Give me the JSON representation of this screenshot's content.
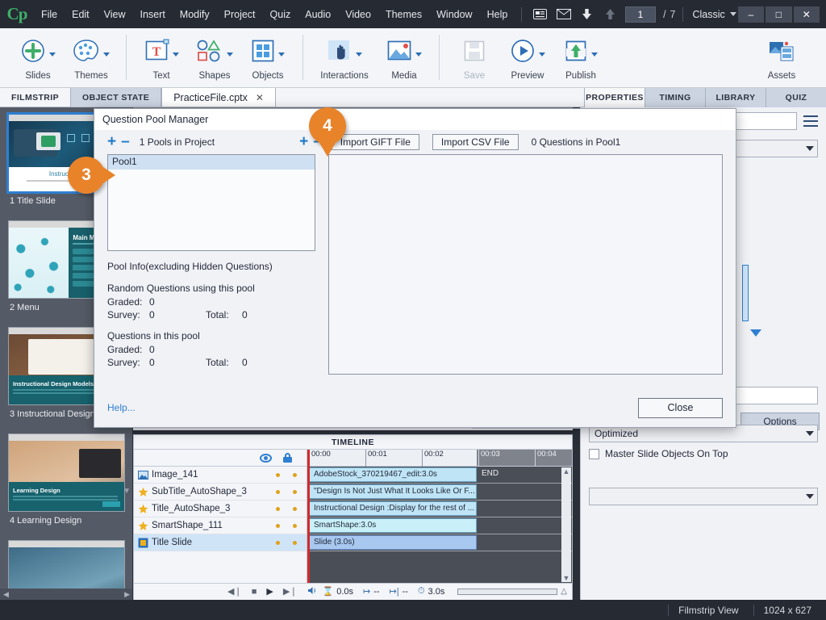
{
  "app": {
    "logo": "Cp",
    "menus": [
      "File",
      "Edit",
      "View",
      "Insert",
      "Modify",
      "Project",
      "Quiz",
      "Audio",
      "Video",
      "Themes",
      "Window",
      "Help"
    ],
    "page_current": "1",
    "page_separator": "/",
    "page_total": "7",
    "workspace": "Classic",
    "window_buttons": {
      "minimize": "–",
      "maximize": "□",
      "close": "✕"
    }
  },
  "ribbon": {
    "items": [
      {
        "label": "Slides",
        "icon": "add-slide-icon",
        "has_caret": true
      },
      {
        "label": "Themes",
        "icon": "palette-icon",
        "has_caret": true
      },
      {
        "label": "Text",
        "icon": "text-box-icon",
        "has_caret": true
      },
      {
        "label": "Shapes",
        "icon": "shapes-icon",
        "has_caret": true
      },
      {
        "label": "Objects",
        "icon": "objects-grid-icon",
        "has_caret": true
      },
      {
        "label": "Interactions",
        "icon": "hand-pointer-icon",
        "has_caret": true
      },
      {
        "label": "Media",
        "icon": "image-icon",
        "has_caret": true
      },
      {
        "label": "Save",
        "icon": "floppy-disk-icon",
        "has_caret": false,
        "disabled": true
      },
      {
        "label": "Preview",
        "icon": "play-circle-icon",
        "has_caret": true
      },
      {
        "label": "Publish",
        "icon": "publish-upload-icon",
        "has_caret": true
      },
      {
        "label": "Assets",
        "icon": "assets-icon",
        "has_caret": false
      }
    ]
  },
  "tabs": {
    "left": [
      {
        "label": "FILMSTRIP",
        "active": false
      },
      {
        "label": "OBJECT STATE",
        "active": false
      }
    ],
    "document": {
      "label": "PracticeFile.cptx",
      "close": "✕"
    },
    "right": [
      {
        "label": "PROPERTIES",
        "active": true
      },
      {
        "label": "TIMING",
        "active": false
      },
      {
        "label": "LIBRARY",
        "active": false
      },
      {
        "label": "QUIZ",
        "active": false
      }
    ]
  },
  "filmstrip": {
    "slides": [
      {
        "caption": "1 Title Slide",
        "selected": true,
        "art": "art1"
      },
      {
        "caption": "2 Menu",
        "selected": false,
        "art": "art2"
      },
      {
        "caption": "3 Instructional Design M...",
        "selected": false,
        "art": "art3"
      },
      {
        "caption": "4 Learning Design",
        "selected": false,
        "art": "art4"
      },
      {
        "caption": "",
        "selected": false,
        "art": "art5"
      }
    ],
    "thumb_titles": {
      "slide1_title": "Instructional",
      "slide2_title": "Main Menu",
      "slide3_title": "Instructional Design Models",
      "slide4_title": "Learning Design"
    }
  },
  "right_panel": {
    "options_button": "Options",
    "optimized_value": "Optimized",
    "master_slide_checkbox": "Master Slide Objects On Top"
  },
  "dialog": {
    "title": "Question Pool Manager",
    "pool_add": "+",
    "pool_remove": "–",
    "pools_count_label": "1 Pools in Project",
    "question_add": "+",
    "question_remove": "–",
    "import_gift": "Import GIFT File",
    "import_csv": "Import CSV File",
    "questions_count_label": "0 Questions in Pool1",
    "pools": [
      {
        "name": "Pool1",
        "selected": true
      }
    ],
    "pool_info": {
      "heading": "Pool Info(excluding Hidden Questions)",
      "section1_title": "Random Questions using this pool",
      "section1_graded_label": "Graded:",
      "section1_graded_value": "0",
      "section1_survey_label": "Survey:",
      "section1_survey_value": "0",
      "section1_total_label": "Total:",
      "section1_total_value": "0",
      "section2_title": "Questions in this pool",
      "section2_graded_label": "Graded:",
      "section2_graded_value": "0",
      "section2_survey_label": "Survey:",
      "section2_survey_value": "0",
      "section2_total_label": "Total:",
      "section2_total_value": "0"
    },
    "help_link": "Help...",
    "close_button": "Close"
  },
  "callouts": [
    {
      "number": "3",
      "direction": "right"
    },
    {
      "number": "4",
      "direction": "down"
    }
  ],
  "timeline": {
    "panel_title": "TIMELINE",
    "ruler_ticks": [
      "00:00",
      "00:01",
      "00:02",
      "00:03",
      "00:04"
    ],
    "rows": [
      {
        "name": "Image_141",
        "icon": "image-icon",
        "bar_label": "AdobeStock_370219467_edit:3.0s",
        "selected": false
      },
      {
        "name": "SubTitle_AutoShape_3",
        "icon": "star-icon",
        "bar_label": "\"Design Is Not Just What It Looks Like Or F...",
        "selected": false
      },
      {
        "name": "Title_AutoShape_3",
        "icon": "star-icon",
        "bar_label": "Instructional Design :Display for the rest of ...",
        "selected": false
      },
      {
        "name": "SmartShape_111",
        "icon": "star-icon",
        "bar_label": "SmartShape:3.0s",
        "selected": false
      },
      {
        "name": "Title Slide",
        "icon": "slide-icon",
        "bar_label": "Slide (3.0s)",
        "selected": true
      }
    ],
    "end_label": "END",
    "controls": {
      "rewind": "◀❘",
      "stop": "■",
      "play": "▶",
      "forward": "▶❘",
      "audio": "ᴴ"
    },
    "status": {
      "start_time": "0.0s",
      "enter_time": "--",
      "exit_time": "--",
      "duration": "3.0s"
    }
  },
  "statusbar": {
    "view_mode": "Filmstrip View",
    "dimensions": "1024 x 627"
  }
}
